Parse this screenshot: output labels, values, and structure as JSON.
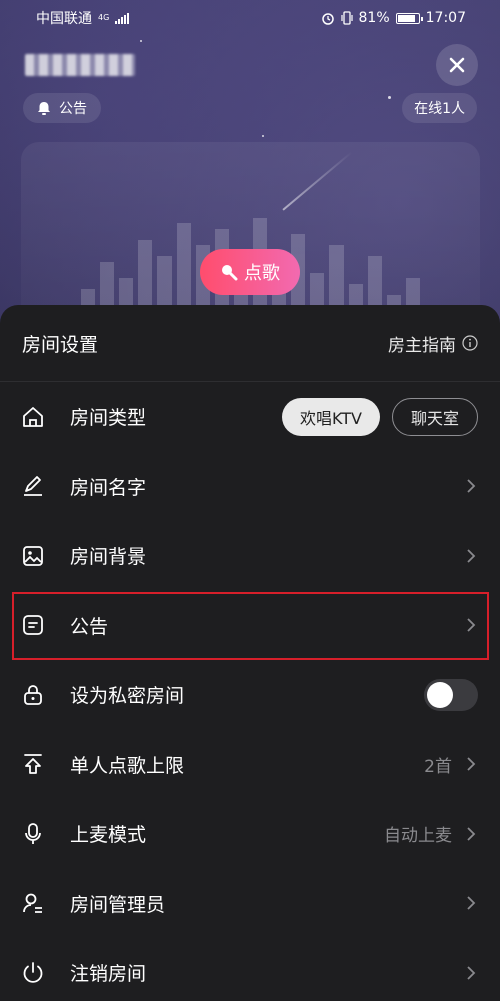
{
  "status_bar": {
    "carrier": "中国联通",
    "network": "4G",
    "battery": "81%",
    "time": "17:07"
  },
  "header": {
    "notice_label": "公告",
    "online_label": "在线1人"
  },
  "stage": {
    "song_button": "点歌"
  },
  "sheet": {
    "title": "房间设置",
    "guide_label": "房主指南",
    "rows": [
      {
        "label": "房间类型",
        "icon": "home-icon",
        "chips": [
          "欢唱KTV",
          "聊天室"
        ],
        "selected": "欢唱KTV"
      },
      {
        "label": "房间名字",
        "icon": "pencil-icon"
      },
      {
        "label": "房间背景",
        "icon": "image-icon"
      },
      {
        "label": "公告",
        "icon": "notice-icon",
        "highlighted": true
      },
      {
        "label": "设为私密房间",
        "icon": "lock-icon",
        "toggle": false
      },
      {
        "label": "单人点歌上限",
        "icon": "upload-icon",
        "value": "2首"
      },
      {
        "label": "上麦模式",
        "icon": "mic-icon",
        "value": "自动上麦"
      },
      {
        "label": "房间管理员",
        "icon": "user-icon"
      },
      {
        "label": "注销房间",
        "icon": "power-icon"
      }
    ]
  },
  "colors": {
    "sheet_bg": "#1e1e20",
    "song_button_gradient": [
      "#ff4d6d",
      "#f26ab0"
    ],
    "highlight": "#d71f2a"
  }
}
